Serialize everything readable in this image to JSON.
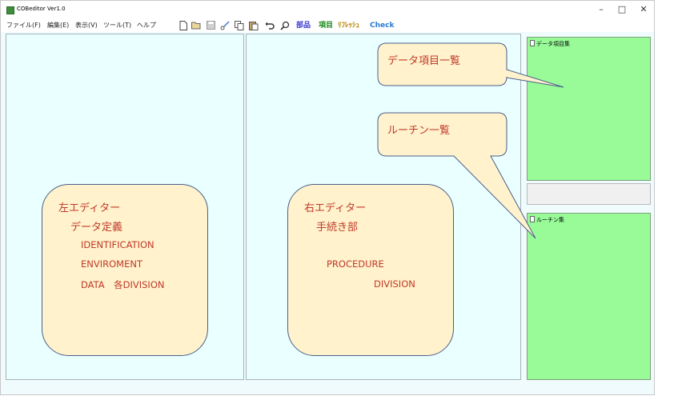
{
  "window": {
    "title": "COBeditor Ver1.0",
    "controls": {
      "minimize": "–",
      "maximize": "□",
      "close": "✕"
    }
  },
  "menu": [
    {
      "label": "ファイル(F)"
    },
    {
      "label": "編集(E)"
    },
    {
      "label": "表示(V)"
    },
    {
      "label": "ツール(T)"
    },
    {
      "label": "ヘルプ"
    }
  ],
  "toolbar": {
    "icons": [
      "new-file",
      "open-folder",
      "save",
      "cut",
      "copy",
      "paste",
      "undo",
      "find"
    ],
    "text_buttons": [
      {
        "label": "部品",
        "color": "#3a3ad0"
      },
      {
        "label": "項目",
        "color": "#1a8a1a"
      },
      {
        "label": "ﾘﾌﾚｯｼｭ",
        "color": "#b8860b"
      },
      {
        "label": "Check",
        "color": "#2a7ad0"
      }
    ]
  },
  "panels": {
    "data_items": {
      "label": "データ項目集"
    },
    "routines": {
      "label": "ルーチン集"
    }
  },
  "callouts": {
    "data_items_list": "データ項目一覧",
    "routine_list": "ルーチン一覧",
    "left_editor": {
      "title": "左エディター",
      "subtitle": "データ定義",
      "lines": [
        "IDENTIFICATION",
        "ENVIROMENT",
        "DATA　各DIVISION"
      ]
    },
    "right_editor": {
      "title": "右エディター",
      "subtitle": "手続き部",
      "lines": [
        "PROCEDURE",
        "DIVISION"
      ]
    }
  },
  "colors": {
    "editor_bg": "#eaffff",
    "panel_green": "#98fb98",
    "callout_fill": "#fff2cc",
    "callout_text": "#c0392b"
  }
}
